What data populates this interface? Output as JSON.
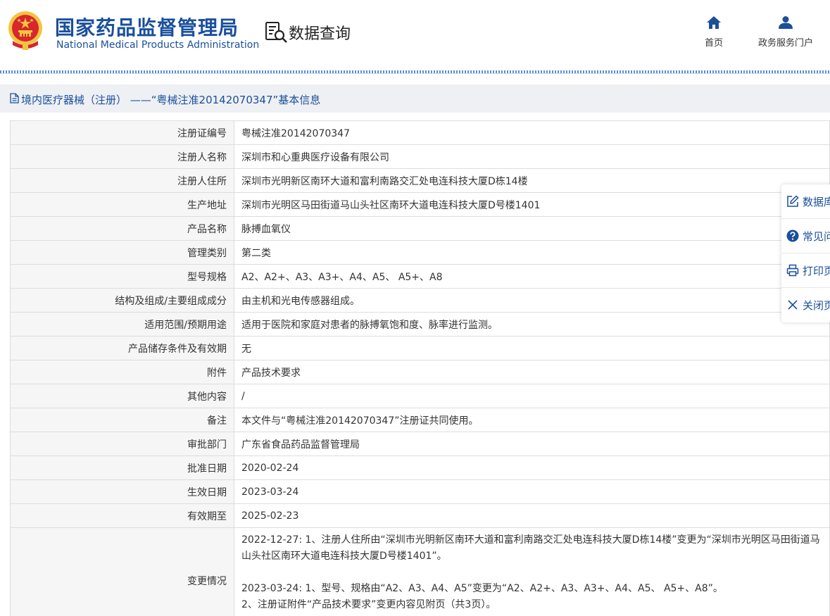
{
  "header": {
    "org_cn": "国家药品监督管理局",
    "org_en": "National Medical Products Administration",
    "section_title": "数据查询",
    "nav": [
      {
        "label": "首页",
        "icon": "home-icon"
      },
      {
        "label": "政务服务门户",
        "icon": "user-icon"
      }
    ]
  },
  "title_bar": {
    "text": "境内医疗器械（注册） ——“粤械注准20142070347”基本信息",
    "icon": "document-icon"
  },
  "fields": [
    {
      "label": "注册证编号",
      "value": "粤械注准20142070347"
    },
    {
      "label": "注册人名称",
      "value": "深圳市和心重典医疗设备有限公司"
    },
    {
      "label": "注册人住所",
      "value": "深圳市光明新区南环大道和富利南路交汇处电连科技大厦D栋14楼"
    },
    {
      "label": "生产地址",
      "value": "深圳市光明区马田街道马山头社区南环大道电连科技大厦D号楼1401"
    },
    {
      "label": "产品名称",
      "value": "脉搏血氧仪"
    },
    {
      "label": "管理类别",
      "value": "第二类"
    },
    {
      "label": "型号规格",
      "value": "A2、A2+、A3、A3+、A4、A5、 A5+、A8"
    },
    {
      "label": "结构及组成/主要组成成分",
      "value": "由主机和光电传感器组成。"
    },
    {
      "label": "适用范围/预期用途",
      "value": "适用于医院和家庭对患者的脉搏氧饱和度、脉率进行监测。"
    },
    {
      "label": "产品储存条件及有效期",
      "value": "无"
    },
    {
      "label": "附件",
      "value": "产品技术要求"
    },
    {
      "label": "其他内容",
      "value": "/"
    },
    {
      "label": "备注",
      "value": "本文件与“粤械注准20142070347”注册证共同使用。"
    },
    {
      "label": "审批部门",
      "value": "广东省食品药品监督管理局"
    },
    {
      "label": "批准日期",
      "value": "2020-02-24"
    },
    {
      "label": "生效日期",
      "value": "2023-03-24"
    },
    {
      "label": "有效期至",
      "value": "2025-02-23"
    }
  ],
  "change": {
    "label": "变更情况",
    "entry1": "2022-12-27: 1、注册人住所由“深圳市光明新区南环大道和富利南路交汇处电连科技大厦D栋14楼”变更为“深圳市光明区马田街道马山头社区南环大道电连科技大厦D号楼1401”。",
    "entry2_line1": "2023-03-24: 1、型号、规格由“A2、A3、A4、A5”变更为“A2、A2+、A3、A3+、A4、A5、 A5+、A8”。",
    "entry2_line2": "2、注册证附件“产品技术要求”变更内容见附页（共3页）。"
  },
  "side_tools": [
    {
      "label": "数据库",
      "icon": "edit-icon"
    },
    {
      "label": "常见问",
      "icon": "question-icon"
    },
    {
      "label": "打印页",
      "icon": "printer-icon"
    },
    {
      "label": "关闭页",
      "icon": "close-icon"
    }
  ],
  "colors": {
    "brand_blue": "#1a4f9c",
    "label_bg": "#f6f6f6",
    "title_bar_bg": "#eef0f3",
    "emblem_red": "#d7262e",
    "emblem_gold": "#f3c53c"
  }
}
